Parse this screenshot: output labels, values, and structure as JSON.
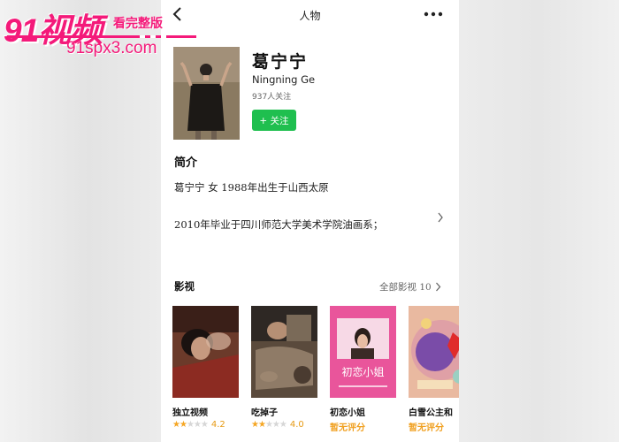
{
  "watermark": {
    "brand": "91视频",
    "tagline": "看完整版",
    "url": "91spx3.com"
  },
  "topbar": {
    "title": "人物",
    "back_icon": "chevron-left-icon",
    "more_icon": "more-dots-icon"
  },
  "profile": {
    "name_zh": "葛宁宁",
    "name_en": "Ningning Ge",
    "followers": "937人关注",
    "follow_label": "+ 关注",
    "follow_color": "#1fbf4f"
  },
  "intro": {
    "title": "简介",
    "line1": "葛宁宁 女 1988年出生于山西太原",
    "line2": "2010年毕业于四川师范大学美术学院油画系；"
  },
  "films": {
    "title": "影视",
    "all_label": "全部影视 10",
    "items": [
      {
        "title": "独立视频",
        "stars": 2,
        "score": "4.2"
      },
      {
        "title": "吃掉子",
        "stars": 2,
        "score": "4.0"
      },
      {
        "title": "初恋小姐",
        "no_score": "暂无评分",
        "poster_text": "初恋小姐"
      },
      {
        "title": "白雪公主和",
        "no_score": "暂无评分"
      }
    ]
  },
  "colors": {
    "accent": "#1fbf4f",
    "rating": "#f5a623",
    "watermark": "#f41a7a"
  }
}
